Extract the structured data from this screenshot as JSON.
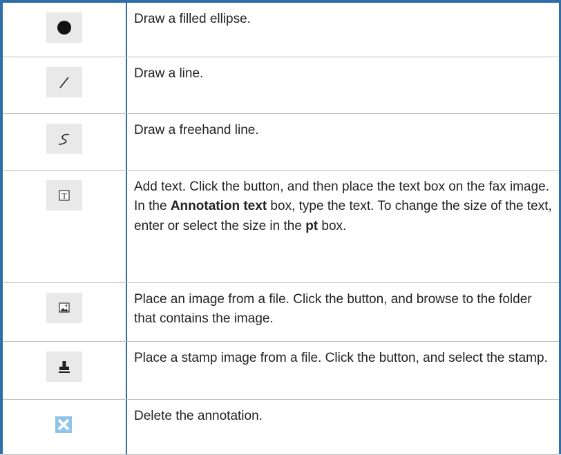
{
  "rows": [
    {
      "icon": "filled-ellipse-icon",
      "text": "Draw a filled ellipse."
    },
    {
      "icon": "line-icon",
      "text": "Draw a line."
    },
    {
      "icon": "freehand-line-icon",
      "text": "Draw a freehand line."
    },
    {
      "icon": "text-box-icon",
      "text_parts": [
        "Add text. Click the button, and then place the text box on the fax image. In the ",
        "Annotation text",
        " box, type the text. To change the size of the text, enter or select the size in the ",
        "pt",
        " box."
      ]
    },
    {
      "icon": "image-icon",
      "text": "Place an image from a file. Click the button, and browse to the folder that contains the image."
    },
    {
      "icon": "stamp-icon",
      "text": "Place a stamp image from a file. Click the button, and select the stamp."
    },
    {
      "icon": "delete-icon",
      "text": "Delete the annotation."
    }
  ],
  "colors": {
    "frame": "#2f6ea6",
    "icon_bg": "#e9e9e9",
    "delete_icon": "#8fc3ea"
  }
}
